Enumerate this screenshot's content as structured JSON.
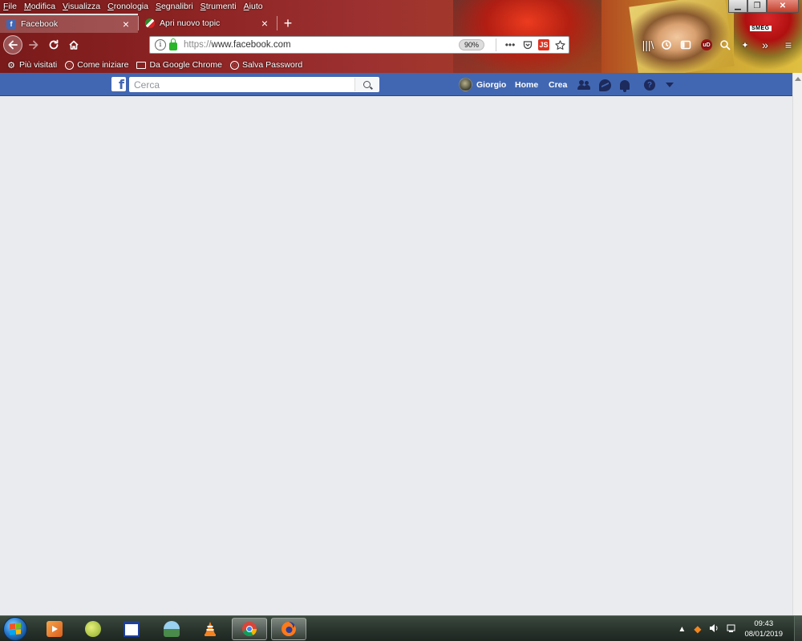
{
  "menu": [
    "File",
    "Modifica",
    "Visualizza",
    "Cronologia",
    "Segnalibri",
    "Strumenti",
    "Aiuto"
  ],
  "theme": {
    "helmet_label": "SMEG"
  },
  "tabs": [
    {
      "title": "Facebook",
      "active": true,
      "favicon": "facebook-favicon"
    },
    {
      "title": "Apri nuovo topic",
      "active": false,
      "favicon": "forum-favicon"
    }
  ],
  "navbar": {
    "url_protocol": "https://",
    "url_host": "www.facebook.com",
    "zoom": "90%",
    "js_label": "JS",
    "ublock_label": "uD",
    "page_actions_glyph": "•••"
  },
  "bookmarks": [
    {
      "label": "Più visitati",
      "icon": "gear-icon"
    },
    {
      "label": "Come iniziare",
      "icon": "globe-icon"
    },
    {
      "label": "Da Google Chrome",
      "icon": "folder-icon"
    },
    {
      "label": "Salva Password",
      "icon": "globe-icon"
    }
  ],
  "facebook": {
    "logo": "f",
    "search_placeholder": "Cerca",
    "user_name": "Giorgio",
    "home_label": "Home",
    "create_label": "Crea",
    "help_glyph": "?"
  },
  "taskbar": {
    "time": "09:43",
    "date": "08/01/2019",
    "tray_expand": "▲"
  },
  "colors": {
    "facebook_blue": "#4267b2",
    "facebook_bg": "#e9ebee",
    "icon_dark": "#1d2a5c"
  }
}
